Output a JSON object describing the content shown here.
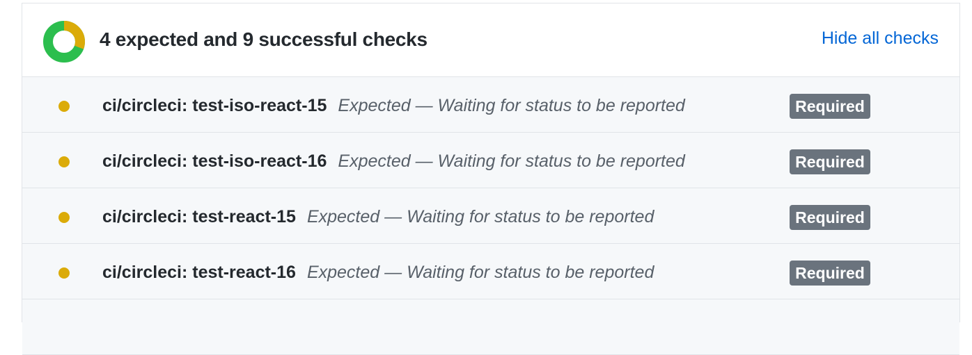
{
  "header": {
    "title": "4 expected and 9 successful checks",
    "hide_link": "Hide all checks",
    "donut": {
      "expected": 4,
      "successful": 9,
      "expected_color": "#dbab09",
      "success_color": "#2cbe4e",
      "icon": "status-donut-icon"
    }
  },
  "checks": [
    {
      "name": "ci/circleci: test-iso-react-15",
      "description": "Expected — Waiting for status to be reported",
      "badge": "Required",
      "status_color": "#dbab09"
    },
    {
      "name": "ci/circleci: test-iso-react-16",
      "description": "Expected — Waiting for status to be reported",
      "badge": "Required",
      "status_color": "#dbab09"
    },
    {
      "name": "ci/circleci: test-react-15",
      "description": "Expected — Waiting for status to be reported",
      "badge": "Required",
      "status_color": "#dbab09"
    },
    {
      "name": "ci/circleci: test-react-16",
      "description": "Expected — Waiting for status to be reported",
      "badge": "Required",
      "status_color": "#dbab09"
    }
  ],
  "colors": {
    "link": "#0366d6",
    "badge_bg": "#6a737d",
    "row_bg": "#f6f8fa",
    "border": "#e1e4e8"
  }
}
